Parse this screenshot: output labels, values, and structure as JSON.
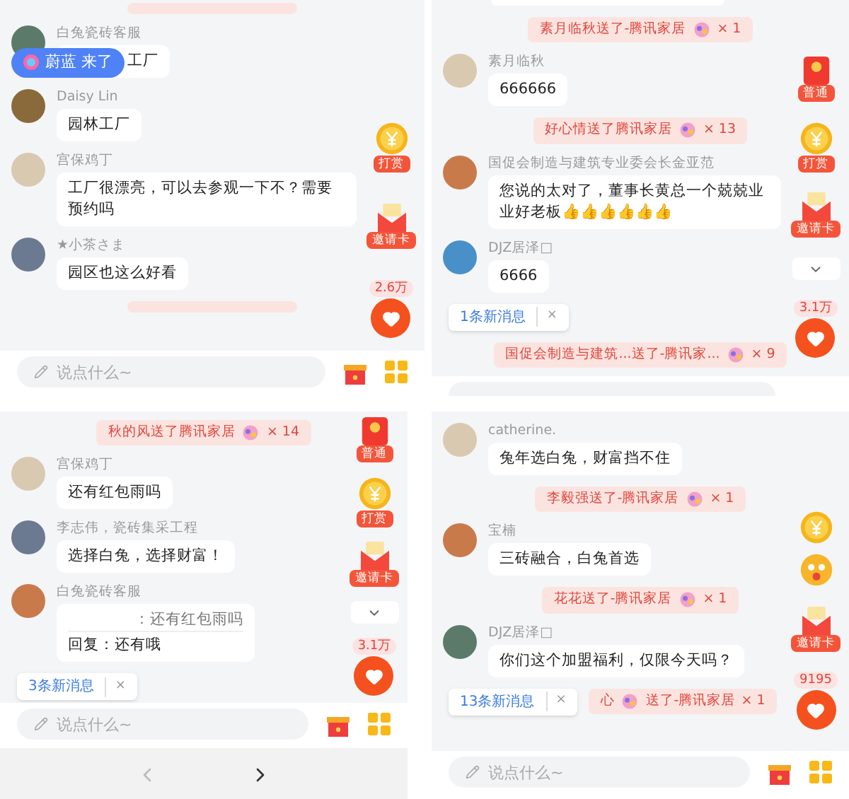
{
  "panels": [
    {
      "messages": [
        {
          "kind": "gift_cut"
        },
        {
          "kind": "chat",
          "name": "白兔瓷砖客服",
          "text": "工厂"
        },
        {
          "kind": "chat",
          "name": "Daisy Lin",
          "text": "园林工厂"
        },
        {
          "kind": "chat",
          "name": "宫保鸡丁",
          "text": "工厂很漂亮，可以去参观一下不？需要预约吗"
        },
        {
          "kind": "chat",
          "name": "★小茶さま",
          "text": "园区也这么好看"
        },
        {
          "kind": "gift_cut"
        }
      ],
      "toast": "蔚蓝 来了",
      "side": [
        {
          "kind": "coin",
          "label": "打赏"
        },
        {
          "kind": "invite",
          "label": "邀请卡"
        },
        {
          "kind": "like",
          "count": "2.6万"
        }
      ],
      "input": {
        "placeholder": "说点什么~"
      }
    },
    {
      "messages": [
        {
          "kind": "bubble_cut"
        },
        {
          "kind": "gift",
          "text": "素月临秋送了-腾讯家居",
          "count": "× 1"
        },
        {
          "kind": "chat",
          "name": "素月临秋",
          "text": "666666"
        },
        {
          "kind": "gift",
          "text": "好心情送了腾讯家居",
          "count": "× 13"
        },
        {
          "kind": "chat",
          "name": "国促会制造与建筑专业委会长金亚范",
          "text": "您说的太对了，董事长黄总一个兢兢业业好老板👍👍👍👍👍👍"
        },
        {
          "kind": "chat",
          "name": "DJZ居泽□",
          "text": "6666"
        },
        {
          "kind": "gift",
          "text": "国促会制造与建筑...送了-腾讯家...",
          "count": "× 9"
        }
      ],
      "badge": {
        "text": "1条新消息",
        "close": "×"
      },
      "side": [
        {
          "kind": "redpacket",
          "label": "普通"
        },
        {
          "kind": "coin",
          "label": "打赏"
        },
        {
          "kind": "invite",
          "label": "邀请卡"
        },
        {
          "kind": "collapse"
        },
        {
          "kind": "like",
          "count": "3.1万"
        }
      ]
    },
    {
      "messages": [
        {
          "kind": "gift",
          "text": "秋的风送了腾讯家居",
          "count": "× 14"
        },
        {
          "kind": "chat",
          "name": "宫保鸡丁",
          "text": "还有红包雨吗"
        },
        {
          "kind": "chat",
          "name": "李志伟，瓷砖集采工程",
          "text": "选择白兔，选择财富！"
        },
        {
          "kind": "reply",
          "name": "白兔瓷砖客服",
          "quote": "：还有红包雨吗",
          "text": "回复：还有哦"
        }
      ],
      "badge": {
        "text": "3条新消息",
        "close": "×"
      },
      "side": [
        {
          "kind": "redpacket",
          "label": "普通"
        },
        {
          "kind": "coin",
          "label": "打赏"
        },
        {
          "kind": "invite",
          "label": "邀请卡"
        },
        {
          "kind": "collapse"
        },
        {
          "kind": "like",
          "count": "3.1万"
        }
      ],
      "input": {
        "placeholder": "说点什么~"
      },
      "nav": [
        {
          "kind": "back",
          "disabled": true
        },
        {
          "kind": "forward",
          "disabled": false
        }
      ]
    },
    {
      "messages": [
        {
          "kind": "chat",
          "name": "catherine.",
          "text": "兔年选白兔，财富挡不住"
        },
        {
          "kind": "gift",
          "text": "李毅强送了-腾讯家居",
          "count": "× 1"
        },
        {
          "kind": "chat",
          "name": "宝楠",
          "text": "三砖融合，白兔首选"
        },
        {
          "kind": "gift",
          "text": "花花送了-腾讯家居",
          "count": "× 1"
        },
        {
          "kind": "chat",
          "name": "DJZ居泽□",
          "text": "你们这个加盟福利，仅限今天吗？"
        },
        {
          "kind": "gift",
          "prefix": "心",
          "text": "送了-腾讯家居",
          "count": "× 1"
        }
      ],
      "badge": {
        "text": "13条新消息",
        "close": "×"
      },
      "side": [
        {
          "kind": "coin"
        },
        {
          "kind": "face"
        },
        {
          "kind": "invite",
          "label": "邀请卡"
        },
        {
          "kind": "like",
          "count": "9195"
        }
      ],
      "input": {
        "placeholder": "说点什么~"
      }
    }
  ]
}
